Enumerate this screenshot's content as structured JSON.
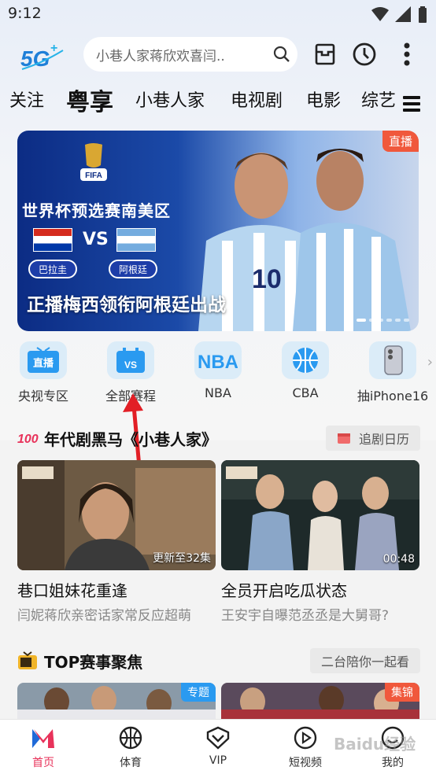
{
  "status_bar": {
    "time": "9:12"
  },
  "header": {
    "logo_text": "5G",
    "search_placeholder": "小巷人家蒋欣欢喜闫..",
    "icons": [
      "search-icon",
      "inbox-icon",
      "history-clock-icon",
      "more-vertical-icon"
    ]
  },
  "tabs": [
    "关注",
    "粤享",
    "小巷人家",
    "电视剧",
    "电影",
    "综艺"
  ],
  "banner": {
    "badge": "直播",
    "event_title": "世界杯预选赛南美区",
    "vs": "VS",
    "team_a": "巴拉圭",
    "team_b": "阿根廷",
    "caption": "正播梅西领衔阿根廷出战",
    "fifa_text": "FIFA"
  },
  "quick_entries": [
    {
      "label": "央视专区",
      "icon_text": "直播"
    },
    {
      "label": "全部赛程",
      "icon_text": "VS"
    },
    {
      "label": "NBA",
      "icon_text": "NBA"
    },
    {
      "label": "CBA",
      "icon_text": ""
    },
    {
      "label": "抽iPhone16",
      "icon_text": ""
    }
  ],
  "section1": {
    "title": "年代剧黑马《小巷人家》",
    "action": "追剧日历",
    "cards": [
      {
        "overlay": "更新至32集",
        "title": "巷口姐妹花重逢",
        "subtitle": "闫妮蒋欣亲密话家常反应超萌"
      },
      {
        "overlay": "00:48",
        "title": "全员开启吃瓜状态",
        "subtitle": "王安宇自曝范丞丞是大舅哥?"
      }
    ]
  },
  "section2": {
    "title": "TOP赛事聚焦",
    "action": "二台陪你一起看",
    "tags": [
      "专题",
      "集锦"
    ]
  },
  "bottom_nav": [
    {
      "label": "首页"
    },
    {
      "label": "体育"
    },
    {
      "label": "VIP"
    },
    {
      "label": "短视频"
    },
    {
      "label": "我的"
    }
  ],
  "watermark": "Baidu经验",
  "colors": {
    "accent": "#e8325a",
    "live_badge": "#f0583c",
    "banner_blue": "#0c2c84"
  }
}
